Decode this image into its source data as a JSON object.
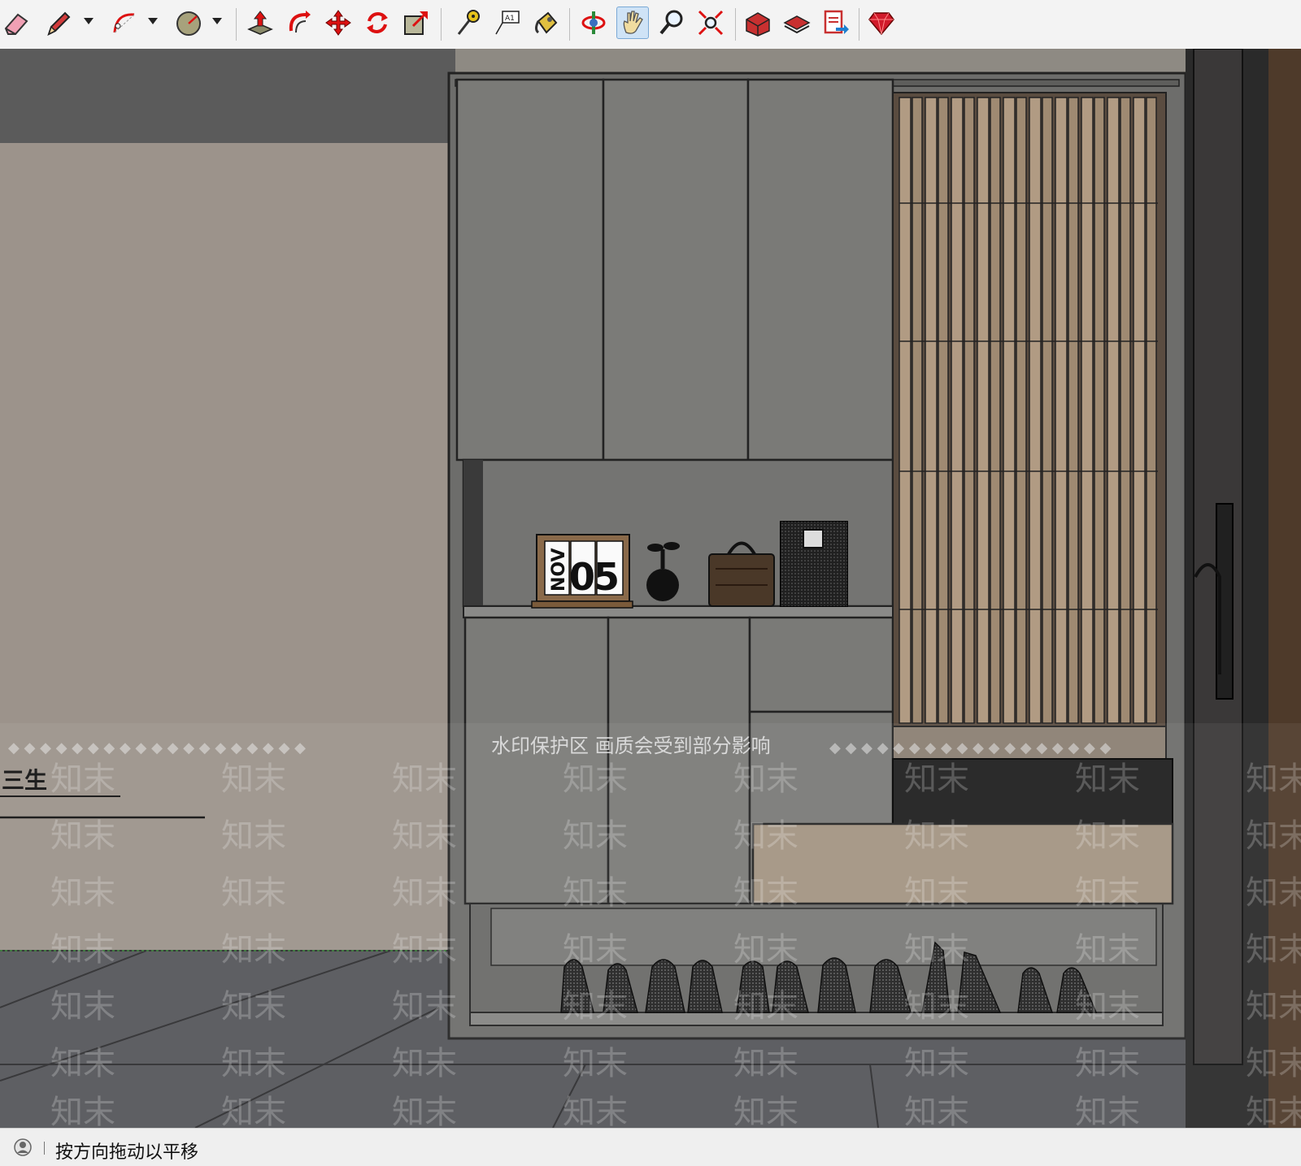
{
  "toolbar": {
    "tools": [
      {
        "name": "eraser-tool"
      },
      {
        "name": "pencil-tool"
      },
      {
        "name": "arc-tool"
      },
      {
        "name": "circle-tool"
      },
      {
        "name": "push-pull-tool"
      },
      {
        "name": "follow-me-tool"
      },
      {
        "name": "move-tool"
      },
      {
        "name": "rotate-tool"
      },
      {
        "name": "scale-tool"
      },
      {
        "name": "tape-measure-tool"
      },
      {
        "name": "text-tool"
      },
      {
        "name": "paint-bucket-tool"
      },
      {
        "name": "orbit-tool"
      },
      {
        "name": "pan-tool",
        "active": true
      },
      {
        "name": "zoom-tool"
      },
      {
        "name": "zoom-extents-tool"
      },
      {
        "name": "3d-warehouse-tool"
      },
      {
        "name": "extension-warehouse-tool"
      },
      {
        "name": "send-to-layout-tool"
      },
      {
        "name": "ruby-console-tool"
      }
    ],
    "text_tool_label": "A1"
  },
  "scene": {
    "wall_sign_text": "三生",
    "calendar_month": "NOV",
    "calendar_day": "05",
    "watermark_notice": "水印保护区  画质会受到部分影响",
    "watermark_brand": "知末"
  },
  "statusbar": {
    "hint": "按方向拖动以平移"
  },
  "colors": {
    "wall": "#9b928a",
    "ceiling": "#595959",
    "cabinet": "#7a7a78",
    "floor": "#55565a",
    "wood_slat": "#b09a82",
    "door_frame": "#2a2a2a"
  }
}
